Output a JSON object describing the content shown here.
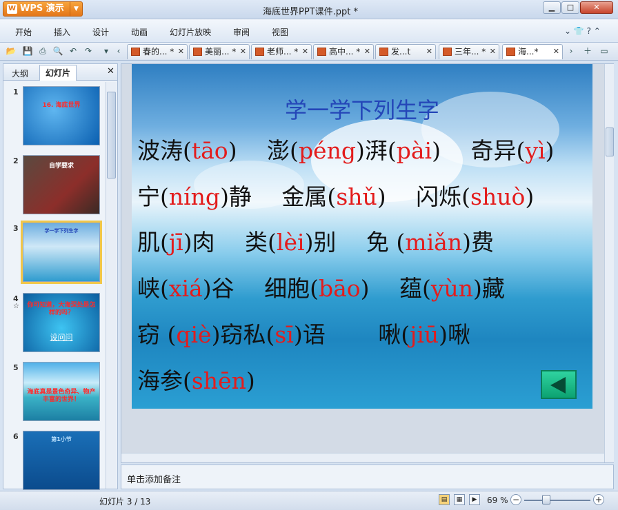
{
  "app": {
    "name": "WPS 演示",
    "logo": "W",
    "doc_title": "海底世界PPT课件.ppt *"
  },
  "menu": [
    "开始",
    "插入",
    "设计",
    "动画",
    "幻灯片放映",
    "审阅",
    "视图"
  ],
  "menu_right": "⌄ 👕 ? ⌃",
  "tabs": [
    {
      "label": "春的... *"
    },
    {
      "label": "美丽... *"
    },
    {
      "label": "老师... *"
    },
    {
      "label": "高中... *"
    },
    {
      "label": "发...t"
    },
    {
      "label": "三年... *"
    },
    {
      "label": "海...*"
    }
  ],
  "left_panel": {
    "tab_outline": "大纲",
    "tab_slides": "幻灯片"
  },
  "thumbnails": [
    {
      "num": "1",
      "text": "16. 海底世界"
    },
    {
      "num": "2",
      "text": "自学要求"
    },
    {
      "num": "3",
      "text": "学一学下列生字"
    },
    {
      "num": "4",
      "text": "你可知道，大海深处是怎样的吗？",
      "link": "设问问"
    },
    {
      "num": "5",
      "text": "海底真是景色奇异、物产丰富的世界！"
    },
    {
      "num": "6",
      "text": "第1小节"
    }
  ],
  "slide": {
    "title": "学一学下列生字",
    "lines": [
      [
        {
          "t": "波涛("
        },
        {
          "p": "tāo"
        },
        {
          "t": ")　 澎("
        },
        {
          "p": "péng"
        },
        {
          "t": ")湃("
        },
        {
          "p": "pài"
        },
        {
          "t": ")　 奇异("
        },
        {
          "p": "yì"
        },
        {
          "t": ")"
        }
      ],
      [
        {
          "t": "宁("
        },
        {
          "p": "níng"
        },
        {
          "t": ")静　 金属("
        },
        {
          "p": "shǔ"
        },
        {
          "t": ")　 闪烁("
        },
        {
          "p": "shuò"
        },
        {
          "t": ")"
        }
      ],
      [
        {
          "t": "肌("
        },
        {
          "p": "jī"
        },
        {
          "t": ")肉　 类("
        },
        {
          "p": "lèi"
        },
        {
          "t": ")别　 免 ("
        },
        {
          "p": "miǎn"
        },
        {
          "t": ")费"
        }
      ],
      [
        {
          "t": "峡("
        },
        {
          "p": "xiá"
        },
        {
          "t": ")谷　 细胞("
        },
        {
          "p": "bāo"
        },
        {
          "t": ")　 蕴("
        },
        {
          "p": "yùn"
        },
        {
          "t": ")藏"
        }
      ],
      [
        {
          "t": "窃 ("
        },
        {
          "p": "qiè"
        },
        {
          "t": ")窃私("
        },
        {
          "p": "sī"
        },
        {
          "t": ")语　　 啾("
        },
        {
          "p": "jiū"
        },
        {
          "t": ")啾"
        }
      ],
      [
        {
          "t": "海参("
        },
        {
          "p": "shēn"
        },
        {
          "t": ")"
        }
      ]
    ]
  },
  "notes_placeholder": "单击添加备注",
  "status": {
    "slide_counter": "幻灯片 3 / 13",
    "zoom": "69 %"
  },
  "colors": {
    "accent": "#e4761a",
    "pinyin": "#e31c1c",
    "title": "#2446b8"
  }
}
